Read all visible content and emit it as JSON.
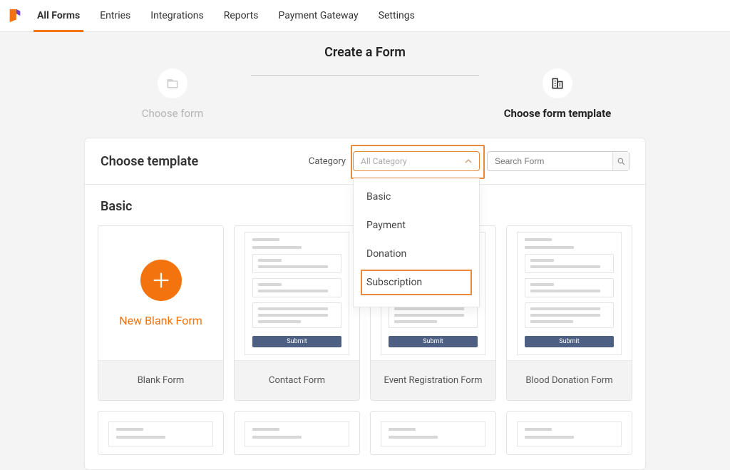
{
  "nav": {
    "items": [
      "All Forms",
      "Entries",
      "Integrations",
      "Reports",
      "Payment Gateway",
      "Settings"
    ],
    "active_index": 0
  },
  "page": {
    "title": "Create a Form"
  },
  "stepper": {
    "steps": [
      {
        "label": "Choose form",
        "state": "muted"
      },
      {
        "label": "Choose form template",
        "state": "active"
      }
    ]
  },
  "panel": {
    "header_title": "Choose template",
    "filter_label": "Category",
    "category_select": {
      "placeholder": "All Category",
      "options": [
        "Basic",
        "Payment",
        "Donation",
        "Subscription"
      ],
      "highlighted": "Subscription"
    },
    "search": {
      "placeholder": "Search Form"
    }
  },
  "templates_section": {
    "title": "Basic",
    "cards": [
      {
        "type": "blank",
        "label": "New Blank Form",
        "footer": "Blank Form"
      },
      {
        "type": "preview",
        "footer": "Contact Form",
        "submit": "Submit"
      },
      {
        "type": "preview",
        "footer": "Event Registration Form",
        "submit": "Submit"
      },
      {
        "type": "preview",
        "footer": "Blood Donation Form",
        "submit": "Submit"
      }
    ]
  },
  "colors": {
    "accent": "#f3730e",
    "submit": "#4d5f82"
  }
}
